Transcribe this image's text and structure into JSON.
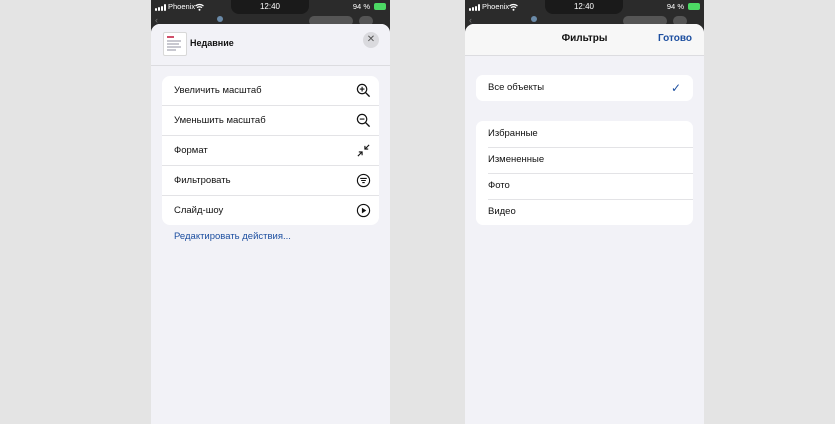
{
  "status": {
    "carrier": "Phoenix",
    "time": "12:40",
    "battery": "94 %"
  },
  "left": {
    "title": "Недавние",
    "close": "✕",
    "actions": [
      {
        "label": "Увеличить масштаб",
        "icon": "zoom-in-icon"
      },
      {
        "label": "Уменьшить масштаб",
        "icon": "zoom-out-icon"
      },
      {
        "label": "Формат",
        "icon": "shrink-arrows-icon"
      },
      {
        "label": "Фильтровать",
        "icon": "filter-icon"
      },
      {
        "label": "Слайд-шоу",
        "icon": "play-icon"
      }
    ],
    "edit_link": "Редактировать действия..."
  },
  "right": {
    "title": "Фильтры",
    "done": "Готово",
    "all_objects": "Все объекты",
    "check": "✓",
    "filters": [
      "Избранные",
      "Измененные",
      "Фото",
      "Видео"
    ]
  },
  "colors": {
    "accent": "#1d4fa0",
    "sheet_bg": "#f2f2f7",
    "page_bg": "#e4e4e4"
  }
}
